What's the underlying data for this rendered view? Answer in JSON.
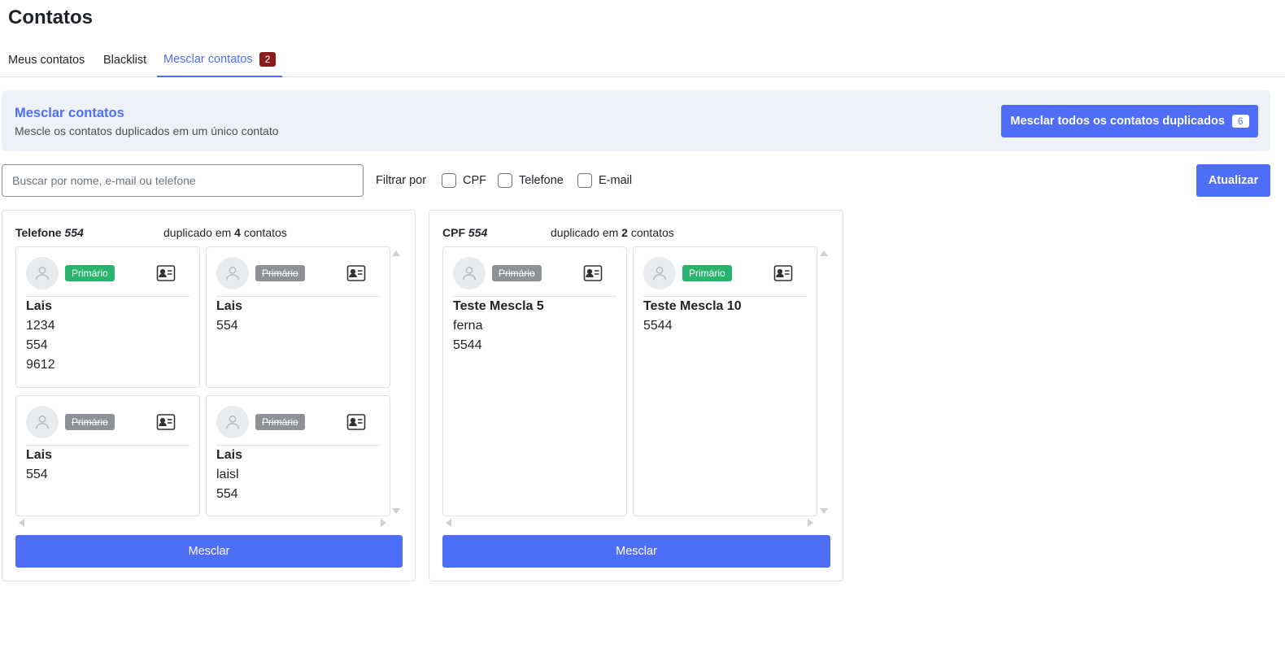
{
  "page": {
    "title": "Contatos"
  },
  "tabs": [
    {
      "label": "Meus contatos"
    },
    {
      "label": "Blacklist"
    },
    {
      "label": "Mesclar contatos",
      "badge": "2",
      "active": true
    }
  ],
  "banner": {
    "title": "Mesclar contatos",
    "subtitle": "Mescle os contatos duplicados em um único contato",
    "merge_all_label": "Mesclar todos os contatos duplicados",
    "merge_all_count": "6"
  },
  "search": {
    "placeholder": "Buscar por nome, e-mail ou telefone",
    "value": ""
  },
  "filters": {
    "label": "Filtrar por",
    "options": [
      {
        "label": "CPF",
        "checked": false
      },
      {
        "label": "Telefone",
        "checked": false
      },
      {
        "label": "E-mail",
        "checked": false
      }
    ]
  },
  "refresh_label": "Atualizar",
  "colors": {
    "accent": "#4f6ef7",
    "primary_badge": "#28b46c",
    "inactive_badge": "#8e9196",
    "tab_badge": "#8b1c1c"
  },
  "groups": [
    {
      "key_label": "Telefone",
      "key_value": "554",
      "dup_prefix": "duplicado em",
      "dup_count": "4",
      "dup_suffix": "contatos",
      "merge_label": "Mesclar",
      "cards": [
        {
          "badge": "Primário",
          "primary": true,
          "name": "Lais",
          "lines": [
            "1234",
            "554",
            "9612"
          ]
        },
        {
          "badge": "Primário",
          "primary": false,
          "name": "Lais",
          "lines": [
            "554"
          ]
        },
        {
          "badge": "Primário",
          "primary": false,
          "name": "Lais",
          "lines": [
            "554"
          ]
        },
        {
          "badge": "Primário",
          "primary": false,
          "name": "Lais",
          "lines": [
            "laisl",
            "554"
          ]
        }
      ]
    },
    {
      "key_label": "CPF",
      "key_value": "554",
      "dup_prefix": "duplicado em",
      "dup_count": "2",
      "dup_suffix": "contatos",
      "merge_label": "Mesclar",
      "cards": [
        {
          "badge": "Primário",
          "primary": false,
          "name": "Teste Mescla 5",
          "lines": [
            "ferna",
            "5544"
          ]
        },
        {
          "badge": "Primário",
          "primary": true,
          "name": "Teste Mescla 10",
          "lines": [
            "5544"
          ]
        }
      ]
    }
  ]
}
